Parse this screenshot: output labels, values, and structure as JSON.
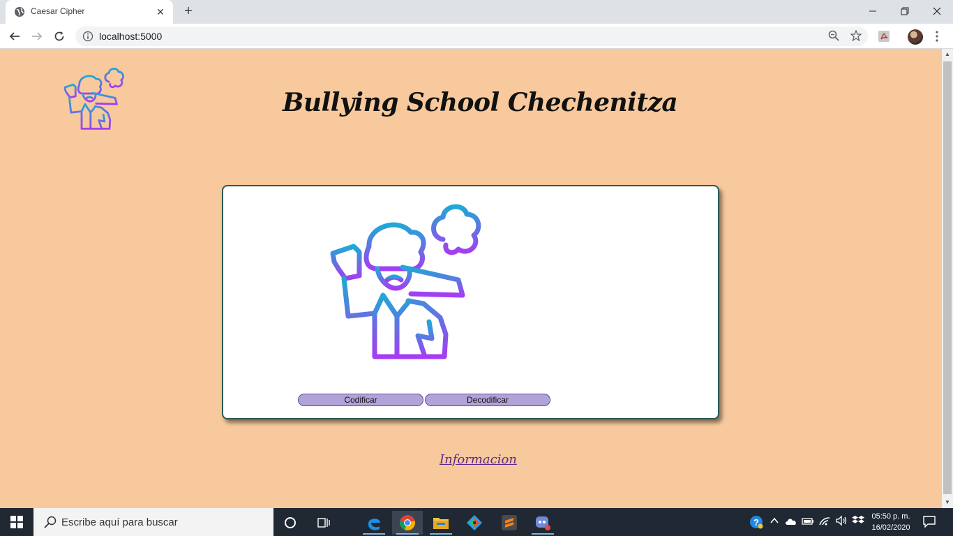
{
  "browser": {
    "tab_title": "Caesar Cipher",
    "url": "localhost:5000",
    "new_tab_label": "+",
    "close_tab_label": "✕"
  },
  "page": {
    "heading": "Bullying School Chechenitza",
    "buttons": {
      "encode": "Codificar",
      "decode": "Decodificar"
    },
    "info_link": "Informacion"
  },
  "taskbar": {
    "search_placeholder": "Escribe aquí para buscar",
    "time": "05:50 p. m.",
    "date": "16/02/2020"
  },
  "colors": {
    "page_background": "#f7c99c",
    "card_border": "#2b5a53",
    "button_fill": "#b1a3d9",
    "gradient_top": "#1fa9d6",
    "gradient_bottom": "#a53df2"
  }
}
